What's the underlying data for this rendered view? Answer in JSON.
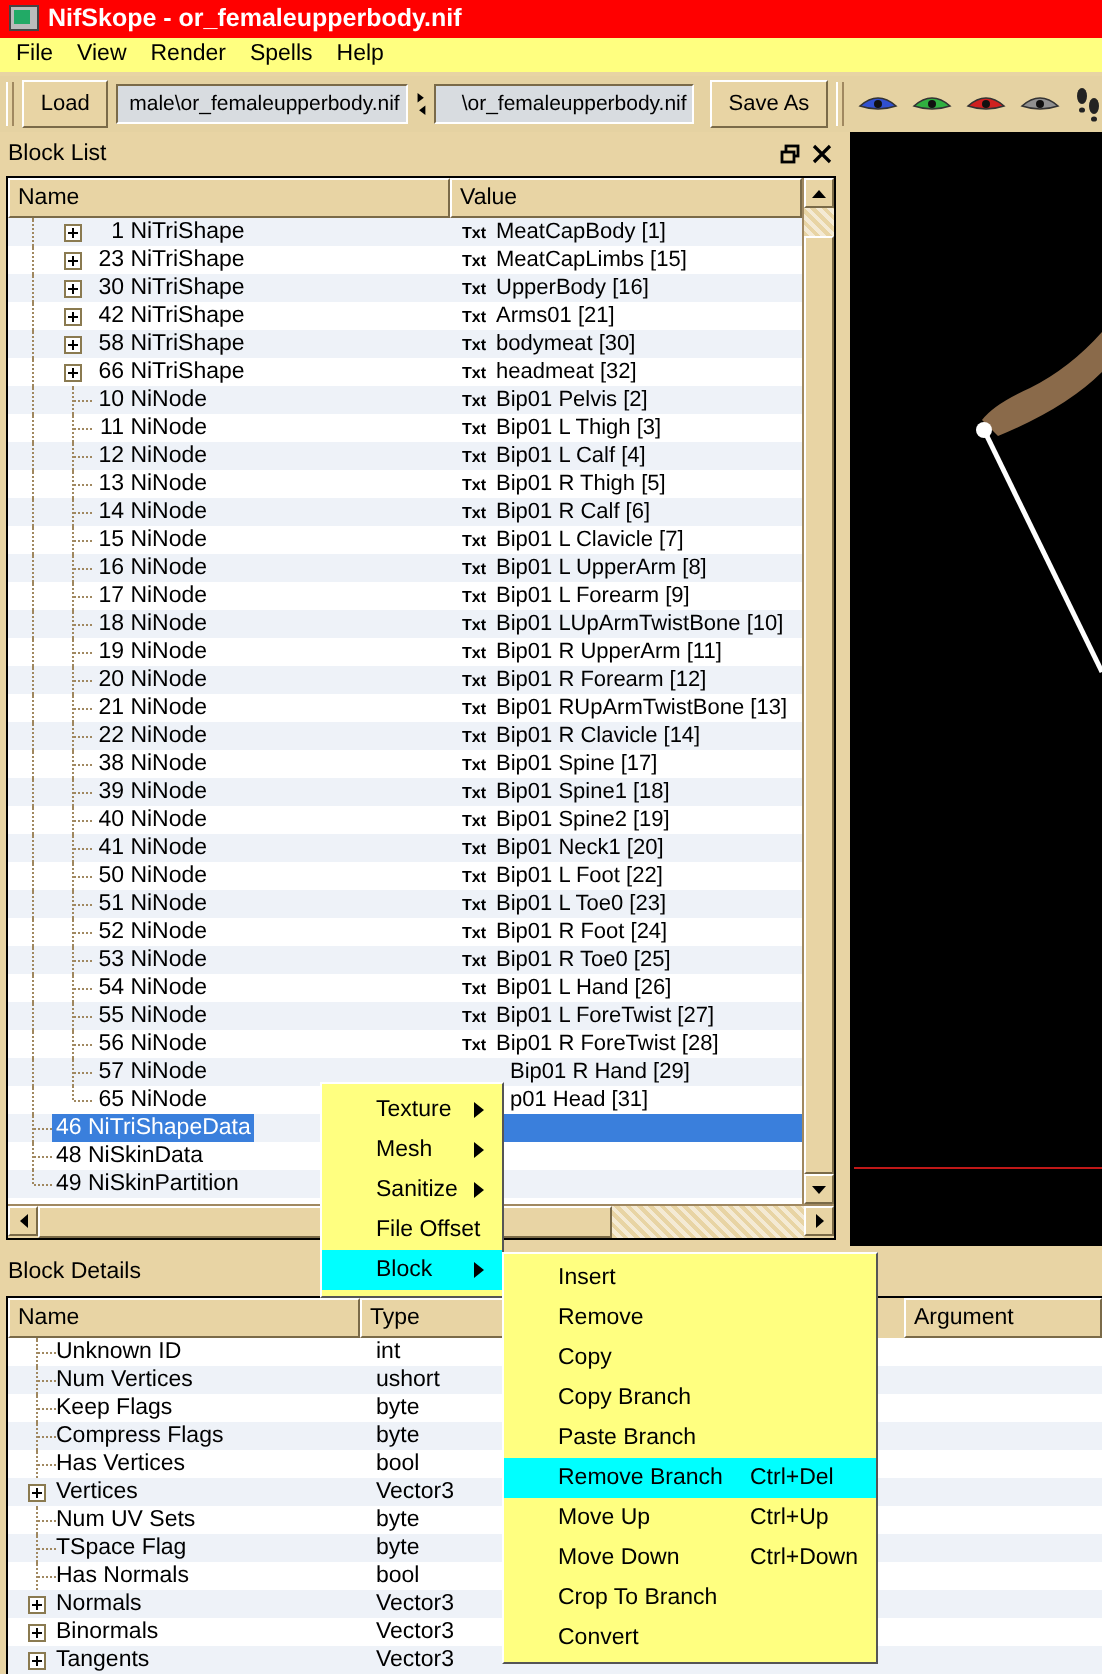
{
  "window": {
    "title": "NifSkope - or_femaleupperbody.nif"
  },
  "menu": [
    "File",
    "View",
    "Render",
    "Spells",
    "Help"
  ],
  "toolbar": {
    "load_button": "Load",
    "source_path": "male\\or_femaleupperbody.nif",
    "target_path": "\\or_femaleupperbody.nif",
    "save_button": "Save As"
  },
  "block_list": {
    "title": "Block List",
    "columns": [
      "Name",
      "Value"
    ],
    "tree": [
      {
        "children": [
          {
            "number": "1",
            "name": "NiTriShape",
            "tag": "Txt",
            "value": "MeatCapBody [1]",
            "expandable": true,
            "selected": false
          },
          {
            "number": "23",
            "name": "NiTriShape",
            "tag": "Txt",
            "value": "MeatCapLimbs [15]",
            "expandable": true,
            "selected": false
          },
          {
            "number": "30",
            "name": "NiTriShape",
            "tag": "Txt",
            "value": "UpperBody [16]",
            "expandable": true,
            "selected": false
          },
          {
            "number": "42",
            "name": "NiTriShape",
            "tag": "Txt",
            "value": "Arms01 [21]",
            "expandable": true,
            "selected": false
          },
          {
            "number": "58",
            "name": "NiTriShape",
            "tag": "Txt",
            "value": "bodymeat [30]",
            "expandable": true,
            "selected": false
          },
          {
            "number": "66",
            "name": "NiTriShape",
            "tag": "Txt",
            "value": "headmeat [32]",
            "expandable": true,
            "selected": false
          },
          {
            "number": "10",
            "name": "NiNode",
            "tag": "Txt",
            "value": "Bip01 Pelvis [2]",
            "expandable": false,
            "selected": false
          },
          {
            "number": "11",
            "name": "NiNode",
            "tag": "Txt",
            "value": "Bip01 L Thigh [3]",
            "expandable": false,
            "selected": false
          },
          {
            "number": "12",
            "name": "NiNode",
            "tag": "Txt",
            "value": "Bip01 L Calf [4]",
            "expandable": false,
            "selected": false
          },
          {
            "number": "13",
            "name": "NiNode",
            "tag": "Txt",
            "value": "Bip01 R Thigh [5]",
            "expandable": false,
            "selected": false
          },
          {
            "number": "14",
            "name": "NiNode",
            "tag": "Txt",
            "value": "Bip01 R Calf [6]",
            "expandable": false,
            "selected": false
          },
          {
            "number": "15",
            "name": "NiNode",
            "tag": "Txt",
            "value": "Bip01 L Clavicle [7]",
            "expandable": false,
            "selected": false
          },
          {
            "number": "16",
            "name": "NiNode",
            "tag": "Txt",
            "value": "Bip01 L UpperArm [8]",
            "expandable": false,
            "selected": false
          },
          {
            "number": "17",
            "name": "NiNode",
            "tag": "Txt",
            "value": "Bip01 L Forearm [9]",
            "expandable": false,
            "selected": false
          },
          {
            "number": "18",
            "name": "NiNode",
            "tag": "Txt",
            "value": "Bip01 LUpArmTwistBone [10]",
            "expandable": false,
            "selected": false
          },
          {
            "number": "19",
            "name": "NiNode",
            "tag": "Txt",
            "value": "Bip01 R UpperArm [11]",
            "expandable": false,
            "selected": false
          },
          {
            "number": "20",
            "name": "NiNode",
            "tag": "Txt",
            "value": "Bip01 R Forearm [12]",
            "expandable": false,
            "selected": false
          },
          {
            "number": "21",
            "name": "NiNode",
            "tag": "Txt",
            "value": "Bip01 RUpArmTwistBone [13]",
            "expandable": false,
            "selected": false
          },
          {
            "number": "22",
            "name": "NiNode",
            "tag": "Txt",
            "value": "Bip01 R Clavicle [14]",
            "expandable": false,
            "selected": false
          },
          {
            "number": "38",
            "name": "NiNode",
            "tag": "Txt",
            "value": "Bip01 Spine [17]",
            "expandable": false,
            "selected": false
          },
          {
            "number": "39",
            "name": "NiNode",
            "tag": "Txt",
            "value": "Bip01 Spine1 [18]",
            "expandable": false,
            "selected": false
          },
          {
            "number": "40",
            "name": "NiNode",
            "tag": "Txt",
            "value": "Bip01 Spine2 [19]",
            "expandable": false,
            "selected": false
          },
          {
            "number": "41",
            "name": "NiNode",
            "tag": "Txt",
            "value": "Bip01 Neck1 [20]",
            "expandable": false,
            "selected": false
          },
          {
            "number": "50",
            "name": "NiNode",
            "tag": "Txt",
            "value": "Bip01 L Foot [22]",
            "expandable": false,
            "selected": false
          },
          {
            "number": "51",
            "name": "NiNode",
            "tag": "Txt",
            "value": "Bip01 L Toe0 [23]",
            "expandable": false,
            "selected": false
          },
          {
            "number": "52",
            "name": "NiNode",
            "tag": "Txt",
            "value": "Bip01 R Foot [24]",
            "expandable": false,
            "selected": false
          },
          {
            "number": "53",
            "name": "NiNode",
            "tag": "Txt",
            "value": "Bip01 R Toe0 [25]",
            "expandable": false,
            "selected": false
          },
          {
            "number": "54",
            "name": "NiNode",
            "tag": "Txt",
            "value": "Bip01 L Hand [26]",
            "expandable": false,
            "selected": false
          },
          {
            "number": "55",
            "name": "NiNode",
            "tag": "Txt",
            "value": "Bip01 L ForeTwist [27]",
            "expandable": false,
            "selected": false
          },
          {
            "number": "56",
            "name": "NiNode",
            "tag": "Txt",
            "value": "Bip01 R ForeTwist [28]",
            "expandable": false,
            "selected": false
          },
          {
            "number": "57",
            "name": "NiNode",
            "value": "Bip01 R Hand [29]",
            "expandable": false,
            "selected": false
          },
          {
            "number": "65",
            "name": "NiNode",
            "value": "p01 Head [31]",
            "expandable": false,
            "selected": false
          }
        ]
      },
      {
        "number": "46",
        "name": "NiTriShapeData",
        "expandable": false,
        "selected": true
      },
      {
        "number": "48",
        "name": "NiSkinData",
        "expandable": false,
        "selected": false
      },
      {
        "number": "49",
        "name": "NiSkinPartition",
        "expandable": false,
        "selected": false
      }
    ]
  },
  "context_menu": {
    "items": [
      {
        "label": "Texture",
        "submenu": true,
        "selected": false
      },
      {
        "label": "Mesh",
        "submenu": true,
        "selected": false
      },
      {
        "label": "Sanitize",
        "submenu": true,
        "selected": false
      },
      {
        "label": "File Offset",
        "submenu": false,
        "selected": false
      },
      {
        "label": "Block",
        "submenu": true,
        "selected": true
      }
    ],
    "submenu": [
      {
        "label": "Insert",
        "selected": false
      },
      {
        "label": "Remove",
        "selected": false
      },
      {
        "label": "Copy",
        "selected": false
      },
      {
        "label": "Copy Branch",
        "selected": false
      },
      {
        "label": "Paste Branch",
        "selected": false
      },
      {
        "label": "Remove Branch",
        "shortcut": "Ctrl+Del",
        "selected": true
      },
      {
        "label": "Move Up",
        "shortcut": "Ctrl+Up",
        "selected": false
      },
      {
        "label": "Move Down",
        "shortcut": "Ctrl+Down",
        "selected": false
      },
      {
        "label": "Crop To Branch",
        "selected": false
      },
      {
        "label": "Convert",
        "selected": false
      }
    ]
  },
  "block_details": {
    "title": "Block Details",
    "columns": [
      "Name",
      "Type",
      "Argument"
    ],
    "rows": [
      {
        "name": "Unknown ID",
        "type": "int",
        "expandable": false
      },
      {
        "name": "Num Vertices",
        "type": "ushort",
        "expandable": false
      },
      {
        "name": "Keep Flags",
        "type": "byte",
        "expandable": false
      },
      {
        "name": "Compress Flags",
        "type": "byte",
        "expandable": false
      },
      {
        "name": "Has Vertices",
        "type": "bool",
        "expandable": false
      },
      {
        "name": "Vertices",
        "type": "Vector3",
        "expandable": true
      },
      {
        "name": "Num UV Sets",
        "type": "byte",
        "expandable": false
      },
      {
        "name": "TSpace Flag",
        "type": "byte",
        "expandable": false
      },
      {
        "name": "Has Normals",
        "type": "bool",
        "expandable": false
      },
      {
        "name": "Normals",
        "type": "Vector3",
        "expandable": true
      },
      {
        "name": "Binormals",
        "type": "Vector3",
        "expandable": true
      },
      {
        "name": "Tangents",
        "type": "Vector3",
        "expandable": true
      }
    ]
  }
}
